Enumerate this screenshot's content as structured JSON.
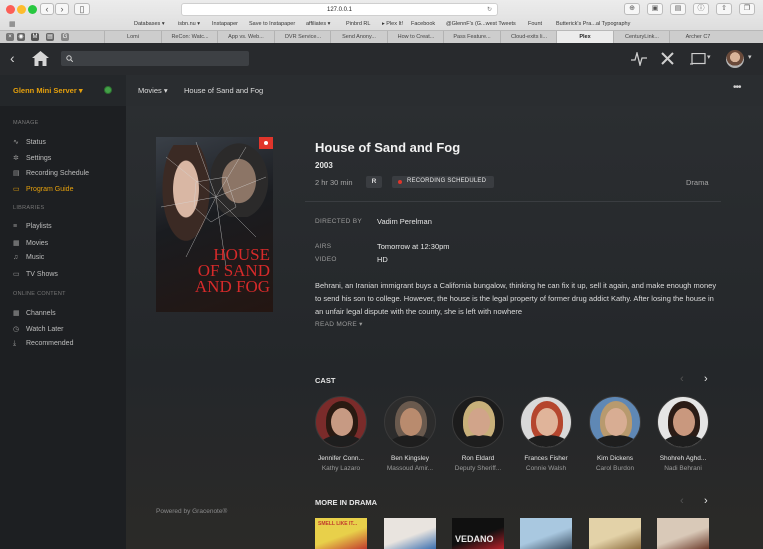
{
  "browser": {
    "url": "127.0.0.1",
    "bookmarks": [
      "Databases ▾",
      "isbn.nu ▾",
      "Instapaper",
      "Save to Instapaper",
      "affiliates ▾",
      "Pinbrd RL",
      "▸ Plex It!",
      "Facebook",
      "@GlennF's (G...west Tweets",
      "Fount",
      "Butterick's Pra...al Typography"
    ],
    "tabs": [
      "Lomi",
      "ReCon: Watc...",
      "App vs. Web...",
      "DVR Service...",
      "Send Anony...",
      "How to Creat...",
      "Pass Feature...",
      "Cloud-exits li...",
      "Plex",
      "CenturyLink...",
      "Archer C7"
    ],
    "active_tab": "Plex"
  },
  "sidebar": {
    "server_name": "Glenn Mini Server ▾",
    "manage_heading": "MANAGE",
    "manage_items": [
      {
        "icon": "pulse-icon",
        "glyph": "∿",
        "label": "Status"
      },
      {
        "icon": "gear-icon",
        "glyph": "✲",
        "label": "Settings"
      },
      {
        "icon": "schedule-icon",
        "glyph": "▤",
        "label": "Recording Schedule"
      },
      {
        "icon": "guide-icon",
        "glyph": "▭",
        "label": "Program Guide",
        "active": true
      }
    ],
    "libraries_heading": "LIBRARIES",
    "library_items": [
      {
        "icon": "playlist-icon",
        "glyph": "≡",
        "label": "Playlists"
      },
      {
        "icon": "film-icon",
        "glyph": "▦",
        "label": "Movies"
      },
      {
        "icon": "music-icon",
        "glyph": "♫",
        "label": "Music"
      },
      {
        "icon": "tv-icon",
        "glyph": "▭",
        "label": "TV Shows"
      }
    ],
    "online_heading": "ONLINE CONTENT",
    "online_items": [
      {
        "icon": "grid-icon",
        "glyph": "▦",
        "label": "Channels"
      },
      {
        "icon": "clock-icon",
        "glyph": "◷",
        "label": "Watch Later"
      },
      {
        "icon": "download-icon",
        "glyph": "⤓",
        "label": "Recommended"
      }
    ],
    "powered_by": "Powered by Gracenote®"
  },
  "breadcrumb": {
    "section": "Movies ▾",
    "title": "House of Sand and Fog"
  },
  "movie": {
    "title": "House of Sand and Fog",
    "year": "2003",
    "duration": "2 hr 30 min",
    "rating": "R",
    "recording_badge": "RECORDING SCHEDULED",
    "genre": "Drama",
    "directed_by_label": "DIRECTED BY",
    "director": "Vadim Perelman",
    "airs_label": "AIRS",
    "airs": "Tomorrow at 12:30pm",
    "video_label": "VIDEO",
    "video": "HD",
    "summary": "Behrani, an Iranian immigrant buys a California bungalow, thinking he can fix it up, sell it again, and make enough money to send his son to college. However, the house is the legal property of former drug addict Kathy. After losing the house in an unfair legal dispute with the county, she is left with nowhere",
    "read_more": "READ MORE ▾",
    "poster_title_lines": [
      "HOUSE",
      "OF SAND",
      "AND FOG"
    ]
  },
  "cast": {
    "heading": "CAST",
    "members": [
      {
        "name": "Jennifer Conn...",
        "role": "Kathy Lazaro",
        "skin": "#c79a83",
        "hair": "#2a1a12",
        "bg": "#7a2b2a"
      },
      {
        "name": "Ben Kingsley",
        "role": "Massoud Amir...",
        "skin": "#b98b6e",
        "hair": "#6a5a4e",
        "bg": "#2c2c2c"
      },
      {
        "name": "Ron Eldard",
        "role": "Deputy Sheriff...",
        "skin": "#d1a48a",
        "hair": "#c8b07a",
        "bg": "#1c1c1c"
      },
      {
        "name": "Frances Fisher",
        "role": "Connie Walsh",
        "skin": "#e0b49a",
        "hair": "#b5462e",
        "bg": "#d9d9d9"
      },
      {
        "name": "Kim Dickens",
        "role": "Carol Burdon",
        "skin": "#d8ad93",
        "hair": "#b89a6e",
        "bg": "#5f88b5"
      },
      {
        "name": "Shohreh Aghd...",
        "role": "Nadi Behrani",
        "skin": "#c9987e",
        "hair": "#2b1c16",
        "bg": "#e5e5e5"
      }
    ]
  },
  "more": {
    "heading": "MORE IN DRAMA",
    "thumbs": [
      {
        "colors": [
          "#e8d04a",
          "#c23b2d"
        ],
        "text": "SMELL LIKE IT..."
      },
      {
        "colors": [
          "#e9e4df",
          "#3a6fb0"
        ],
        "text": ""
      },
      {
        "colors": [
          "#101010",
          "#b8202a"
        ],
        "text": "VEDANO"
      },
      {
        "colors": [
          "#a9c8e0",
          "#3b4f63"
        ],
        "text": ""
      },
      {
        "colors": [
          "#e3d2a8",
          "#8a6a3c"
        ],
        "text": ""
      },
      {
        "colors": [
          "#d9c9b8",
          "#6b3b2b"
        ],
        "text": ""
      }
    ]
  },
  "colors": {
    "accent": "#e5a00d",
    "record_red": "#e0352b",
    "online_green": "#43a047"
  }
}
